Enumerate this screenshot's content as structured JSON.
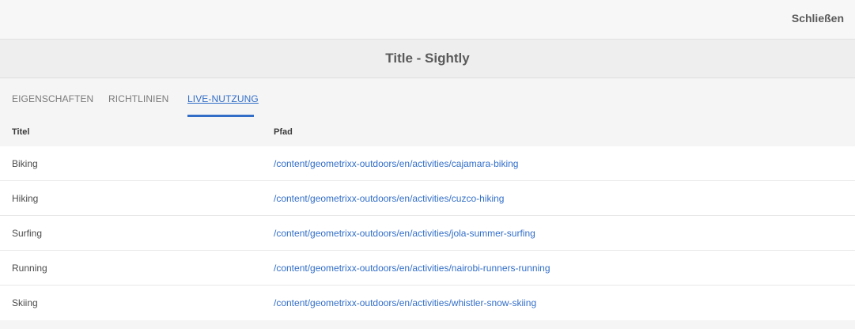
{
  "header": {
    "close_label": "Schließen"
  },
  "dialog": {
    "title": "Title - Sightly"
  },
  "tabs": [
    {
      "label": "EIGENSCHAFTEN"
    },
    {
      "label": "RICHTLINIEN"
    },
    {
      "label": "LIVE-NUTZUNG",
      "active": true
    }
  ],
  "table": {
    "columns": [
      "Titel",
      "Pfad"
    ],
    "rows": [
      {
        "title": "Biking",
        "path": "/content/geometrixx-outdoors/en/activities/cajamara-biking"
      },
      {
        "title": "Hiking",
        "path": "/content/geometrixx-outdoors/en/activities/cuzco-hiking"
      },
      {
        "title": "Surfing",
        "path": "/content/geometrixx-outdoors/en/activities/jola-summer-surfing"
      },
      {
        "title": "Running",
        "path": "/content/geometrixx-outdoors/en/activities/nairobi-runners-running"
      },
      {
        "title": "Skiing",
        "path": "/content/geometrixx-outdoors/en/activities/whistler-snow-skiing"
      }
    ]
  },
  "colors": {
    "accent": "#326ec8",
    "background": "#f5f5f5",
    "row_background": "#ffffff"
  }
}
